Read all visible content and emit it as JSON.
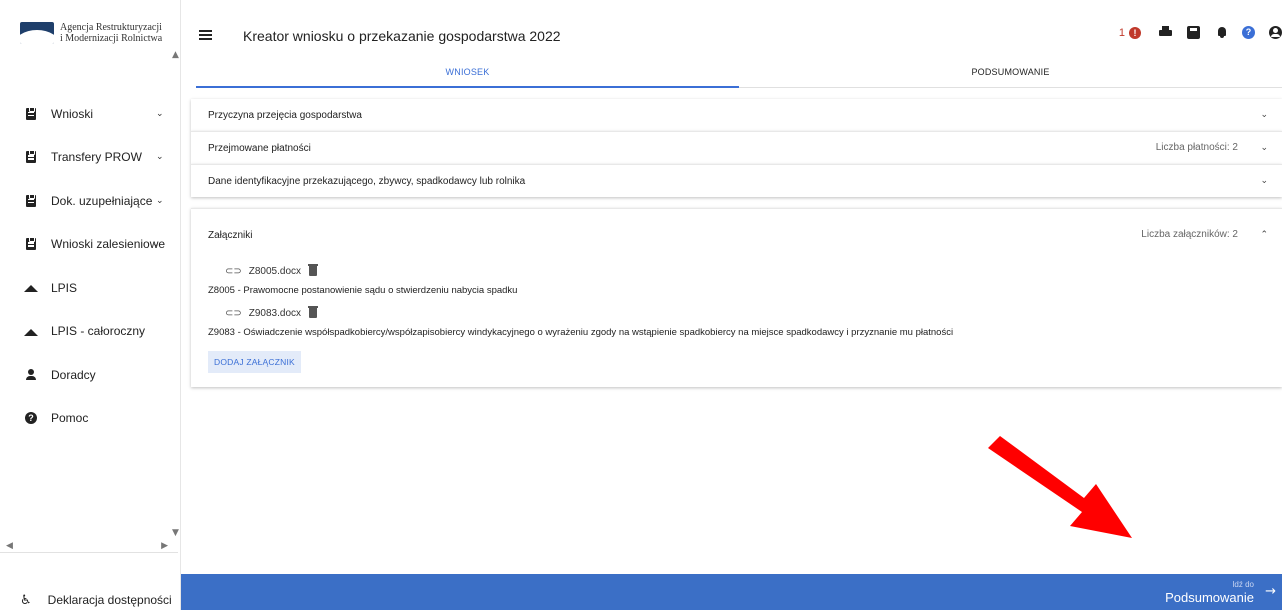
{
  "sidebar": {
    "logo_line1": "Agencja Restrukturyzacji",
    "logo_line2": "i Modernizacji Rolnictwa",
    "logo_small": "ARiMR",
    "items": [
      {
        "label": "Wnioski",
        "icon": "document-icon",
        "has_chevron": true
      },
      {
        "label": "Transfery PROW",
        "icon": "document-icon",
        "has_chevron": true
      },
      {
        "label": "Dok. uzupełniające",
        "icon": "document-icon",
        "has_chevron": true
      },
      {
        "label": "Wnioski zalesieniowe",
        "icon": "document-icon",
        "has_chevron": true
      },
      {
        "label": "LPIS",
        "icon": "terrain-icon",
        "has_chevron": false
      },
      {
        "label": "LPIS - całoroczny",
        "icon": "terrain-icon",
        "has_chevron": false
      },
      {
        "label": "Doradcy",
        "icon": "person-icon",
        "has_chevron": false
      },
      {
        "label": "Pomoc",
        "icon": "help-icon",
        "has_chevron": false
      }
    ],
    "accessibility_label": "Deklaracja dostępności"
  },
  "header": {
    "title": "Kreator wniosku o przekazanie gospodarstwa 2022",
    "alert_count": "1",
    "alert_glyph": "!",
    "help_glyph": "?"
  },
  "tabs": [
    {
      "label": "WNIOSEK",
      "active": true
    },
    {
      "label": "PODSUMOWANIE",
      "active": false
    }
  ],
  "panels": [
    {
      "title": "Przyczyna przejęcia gospodarstwa",
      "meta": ""
    },
    {
      "title": "Przejmowane płatności",
      "meta": "Liczba płatności: 2"
    },
    {
      "title": "Dane identyfikacyjne przekazującego, zbywcy, spadkodawcy lub rolnika",
      "meta": ""
    }
  ],
  "attachments": {
    "title": "Załączniki",
    "meta": "Liczba załączników: 2",
    "files": [
      {
        "filename": "Z8005.docx",
        "description": "Z8005 - Prawomocne postanowienie sądu o stwierdzeniu nabycia spadku"
      },
      {
        "filename": "Z9083.docx",
        "description": "Z9083 - Oświadczenie współspadkobiercy/współzapisobiercy windykacyjnego o wyrażeniu zgody na wstąpienie spadkobiercy na miejsce spadkodawcy i przyznanie mu płatności"
      }
    ],
    "add_label": "DODAJ ZAŁĄCZNIK"
  },
  "footer": {
    "goto_small": "Idź do",
    "goto_big": "Podsumowanie"
  },
  "colors": {
    "accent": "#3b6fd6",
    "footer": "#3b6fc6",
    "alert": "#c0392b",
    "annotation_arrow": "#ff0000"
  }
}
